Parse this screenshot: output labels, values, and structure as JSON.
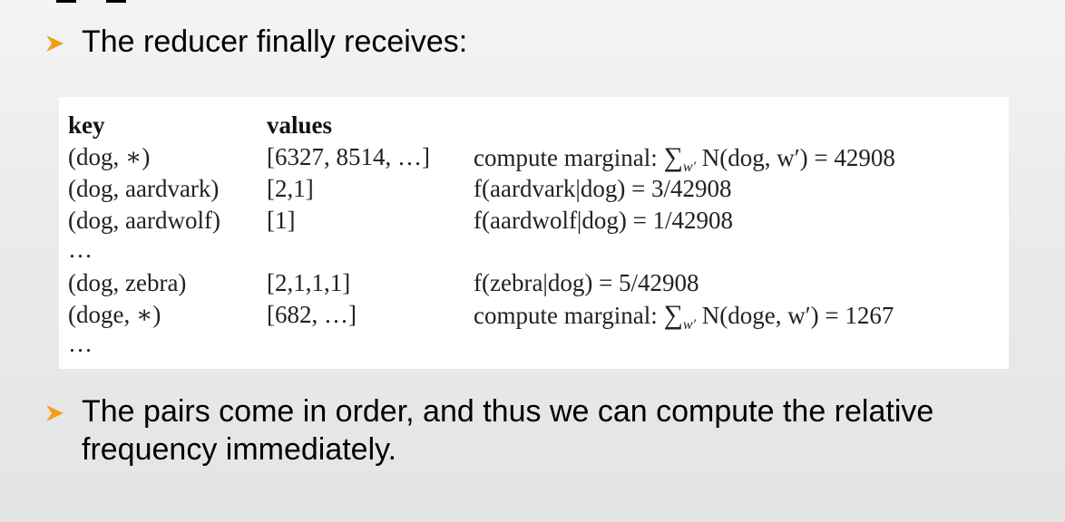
{
  "slide": {
    "bullets": [
      {
        "text": "The reducer finally receives:"
      },
      {
        "text": "The pairs come in order, and thus we can compute the relative frequency immediately."
      }
    ],
    "bullet_color": "#f0a018"
  },
  "table": {
    "headers": {
      "key": "key",
      "values": "values"
    },
    "rows": [
      {
        "key": "(dog, ∗)",
        "values": "[6327, 8514, …]",
        "compute_prefix": "compute marginal: ",
        "sigma": "∑",
        "sigma_sub": "w′",
        "compute_expr": " N(dog, w′) = 42908"
      },
      {
        "key": "(dog, aardvark)",
        "values": "[2,1]",
        "compute_expr": "f(aardvark|dog) = 3/42908"
      },
      {
        "key": "(dog, aardwolf)",
        "values": "[1]",
        "compute_expr": "f(aardwolf|dog) = 1/42908"
      },
      {
        "key": "…"
      },
      {
        "key": "(dog, zebra)",
        "values": "[2,1,1,1]",
        "compute_expr": "f(zebra|dog) = 5/42908"
      },
      {
        "key": "(doge, ∗)",
        "values": "[682, …]",
        "compute_prefix": "compute marginal: ",
        "sigma": "∑",
        "sigma_sub": "w′",
        "compute_expr": " N(doge, w′) = 1267"
      },
      {
        "key": "…"
      }
    ]
  }
}
